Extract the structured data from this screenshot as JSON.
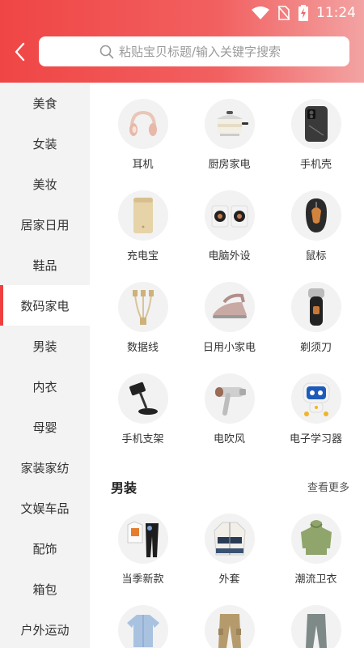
{
  "status": {
    "time": "11:24"
  },
  "search": {
    "placeholder": "粘贴宝贝标题/输入关键字搜索"
  },
  "colors": {
    "accent": "#ef4040",
    "header_start": "#f04545",
    "header_end": "#f3a3a3"
  },
  "sidebar": {
    "items": [
      {
        "label": "美食"
      },
      {
        "label": "女装"
      },
      {
        "label": "美妆"
      },
      {
        "label": "居家日用"
      },
      {
        "label": "鞋品"
      },
      {
        "label": "数码家电",
        "active": true
      },
      {
        "label": "男装"
      },
      {
        "label": "内衣"
      },
      {
        "label": "母婴"
      },
      {
        "label": "家装家纺"
      },
      {
        "label": "文娱车品"
      },
      {
        "label": "配饰"
      },
      {
        "label": "箱包"
      },
      {
        "label": "户外运动"
      }
    ]
  },
  "digital": {
    "items": [
      {
        "label": "耳机",
        "icon": "headphones-icon"
      },
      {
        "label": "厨房家电",
        "icon": "cooking-pot-icon"
      },
      {
        "label": "手机壳",
        "icon": "phone-case-icon"
      },
      {
        "label": "充电宝",
        "icon": "power-bank-icon"
      },
      {
        "label": "电脑外设",
        "icon": "speaker-icon"
      },
      {
        "label": "鼠标",
        "icon": "mouse-icon"
      },
      {
        "label": "数据线",
        "icon": "cable-icon"
      },
      {
        "label": "日用小家电",
        "icon": "iron-icon"
      },
      {
        "label": "剃须刀",
        "icon": "shaver-icon"
      },
      {
        "label": "手机支架",
        "icon": "phone-stand-icon"
      },
      {
        "label": "电吹风",
        "icon": "hair-dryer-icon"
      },
      {
        "label": "电子学习器",
        "icon": "learning-robot-icon"
      }
    ]
  },
  "menswear": {
    "title": "男装",
    "more": "查看更多",
    "items": [
      {
        "label": "当季新款",
        "icon": "outfit-icon"
      },
      {
        "label": "外套",
        "icon": "jacket-icon"
      },
      {
        "label": "潮流卫衣",
        "icon": "hoodie-icon"
      },
      {
        "label": "",
        "icon": "shirt-icon"
      },
      {
        "label": "",
        "icon": "cargo-pants-icon"
      },
      {
        "label": "",
        "icon": "trousers-icon"
      }
    ]
  }
}
